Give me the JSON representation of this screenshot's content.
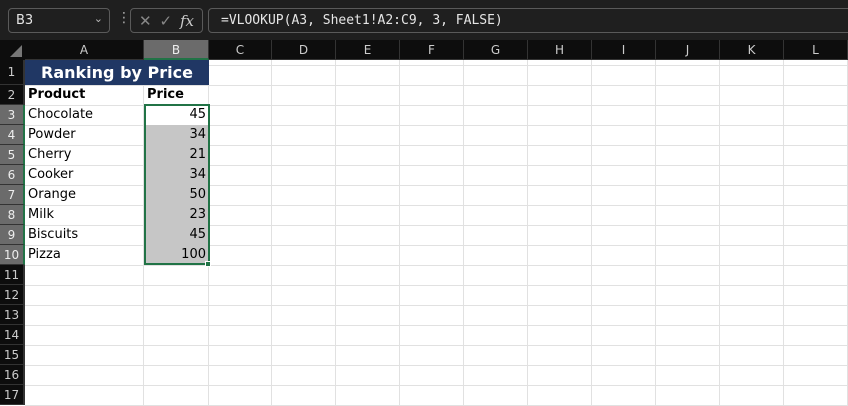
{
  "toolbar": {
    "name_box": "B3",
    "formula": "=VLOOKUP(A3, Sheet1!A2:C9, 3, FALSE)",
    "fx_label": "fx",
    "cancel_glyph": "✕",
    "enter_glyph": "✓"
  },
  "columns": [
    "A",
    "B",
    "C",
    "D",
    "E",
    "F",
    "G",
    "H",
    "I",
    "J",
    "K",
    "L"
  ],
  "rows": [
    "1",
    "2",
    "3",
    "4",
    "5",
    "6",
    "7",
    "8",
    "9",
    "10",
    "11",
    "12",
    "13",
    "14",
    "15",
    "16",
    "17"
  ],
  "sheet": {
    "title": "Ranking by Price",
    "header_product": "Product",
    "header_price": "Price",
    "items": [
      {
        "product": "Chocolate",
        "price": "45"
      },
      {
        "product": "Powder",
        "price": "34"
      },
      {
        "product": "Cherry",
        "price": "21"
      },
      {
        "product": "Cooker",
        "price": "34"
      },
      {
        "product": "Orange",
        "price": "50"
      },
      {
        "product": "Milk",
        "price": "23"
      },
      {
        "product": "Biscuits",
        "price": "45"
      },
      {
        "product": "Pizza",
        "price": "100"
      }
    ]
  },
  "colors": {
    "title_bg": "#203764",
    "selection": "#217346"
  }
}
